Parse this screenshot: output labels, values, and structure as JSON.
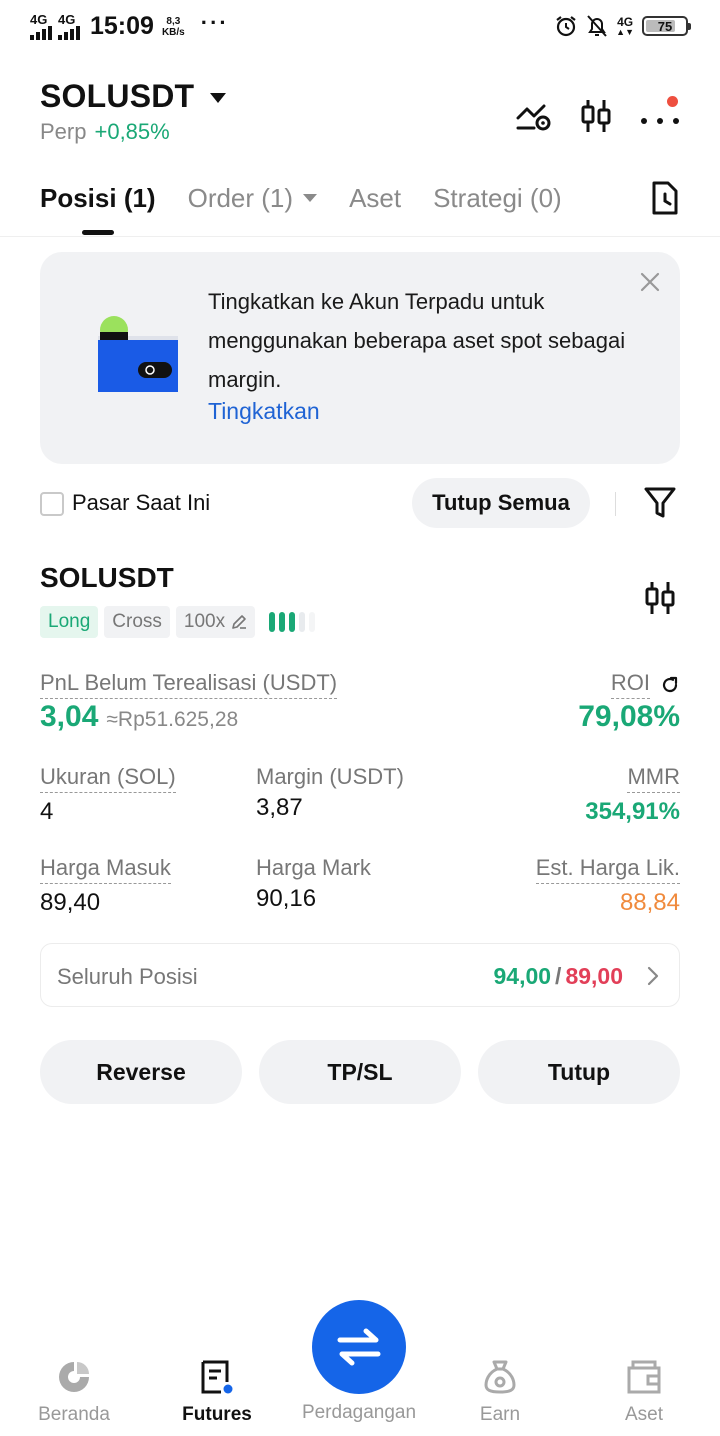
{
  "status_bar": {
    "sim1": "4G",
    "sim2": "4G",
    "time": "15:09",
    "speed_value": "8,3",
    "speed_unit": "KB/s",
    "network": "4G",
    "battery": "75"
  },
  "header": {
    "symbol": "SOLUSDT",
    "type": "Perp",
    "change": "+0,85%"
  },
  "tabs": [
    {
      "label": "Posisi (1)"
    },
    {
      "label": "Order (1)"
    },
    {
      "label": "Aset"
    },
    {
      "label": "Strategi (0)"
    }
  ],
  "banner": {
    "text": "Tingkatkan ke Akun Terpadu untuk menggunakan beberapa aset spot sebagai margin.",
    "link": "Tingkatkan"
  },
  "filter": {
    "checkbox_label": "Pasar Saat Ini",
    "close_all": "Tutup Semua"
  },
  "position": {
    "symbol": "SOLUSDT",
    "side": "Long",
    "margin_mode": "Cross",
    "leverage": "100x",
    "risk_level_filled": 3,
    "risk_level_total": 5,
    "pnl_label": "PnL Belum Terealisasi (USDT)",
    "pnl_value": "3,04",
    "pnl_fiat": "≈Rp51.625,28",
    "roi_label": "ROI",
    "roi_value": "79,08%",
    "size_label": "Ukuran (SOL)",
    "size_value": "4",
    "margin_label": "Margin (USDT)",
    "margin_value": "3,87",
    "mmr_label": "MMR",
    "mmr_value": "354,91%",
    "entry_label": "Harga Masuk",
    "entry_value": "89,40",
    "mark_label": "Harga Mark",
    "mark_value": "90,16",
    "liq_label": "Est. Harga Lik.",
    "liq_value": "88,84",
    "tpsl_all_label": "Seluruh Posisi",
    "tp_value": "94,00",
    "tpsl_separator": "/",
    "sl_value": "89,00",
    "actions": {
      "reverse": "Reverse",
      "tpsl": "TP/SL",
      "close": "Tutup"
    }
  },
  "bottom_nav": {
    "home": "Beranda",
    "futures": "Futures",
    "trade": "Perdagangan",
    "earn": "Earn",
    "assets": "Aset"
  },
  "colors": {
    "green": "#1aa876",
    "red": "#e23f58",
    "orange": "#f08a3c",
    "blue_link": "#1f63d4",
    "fab_blue": "#1565e8"
  }
}
